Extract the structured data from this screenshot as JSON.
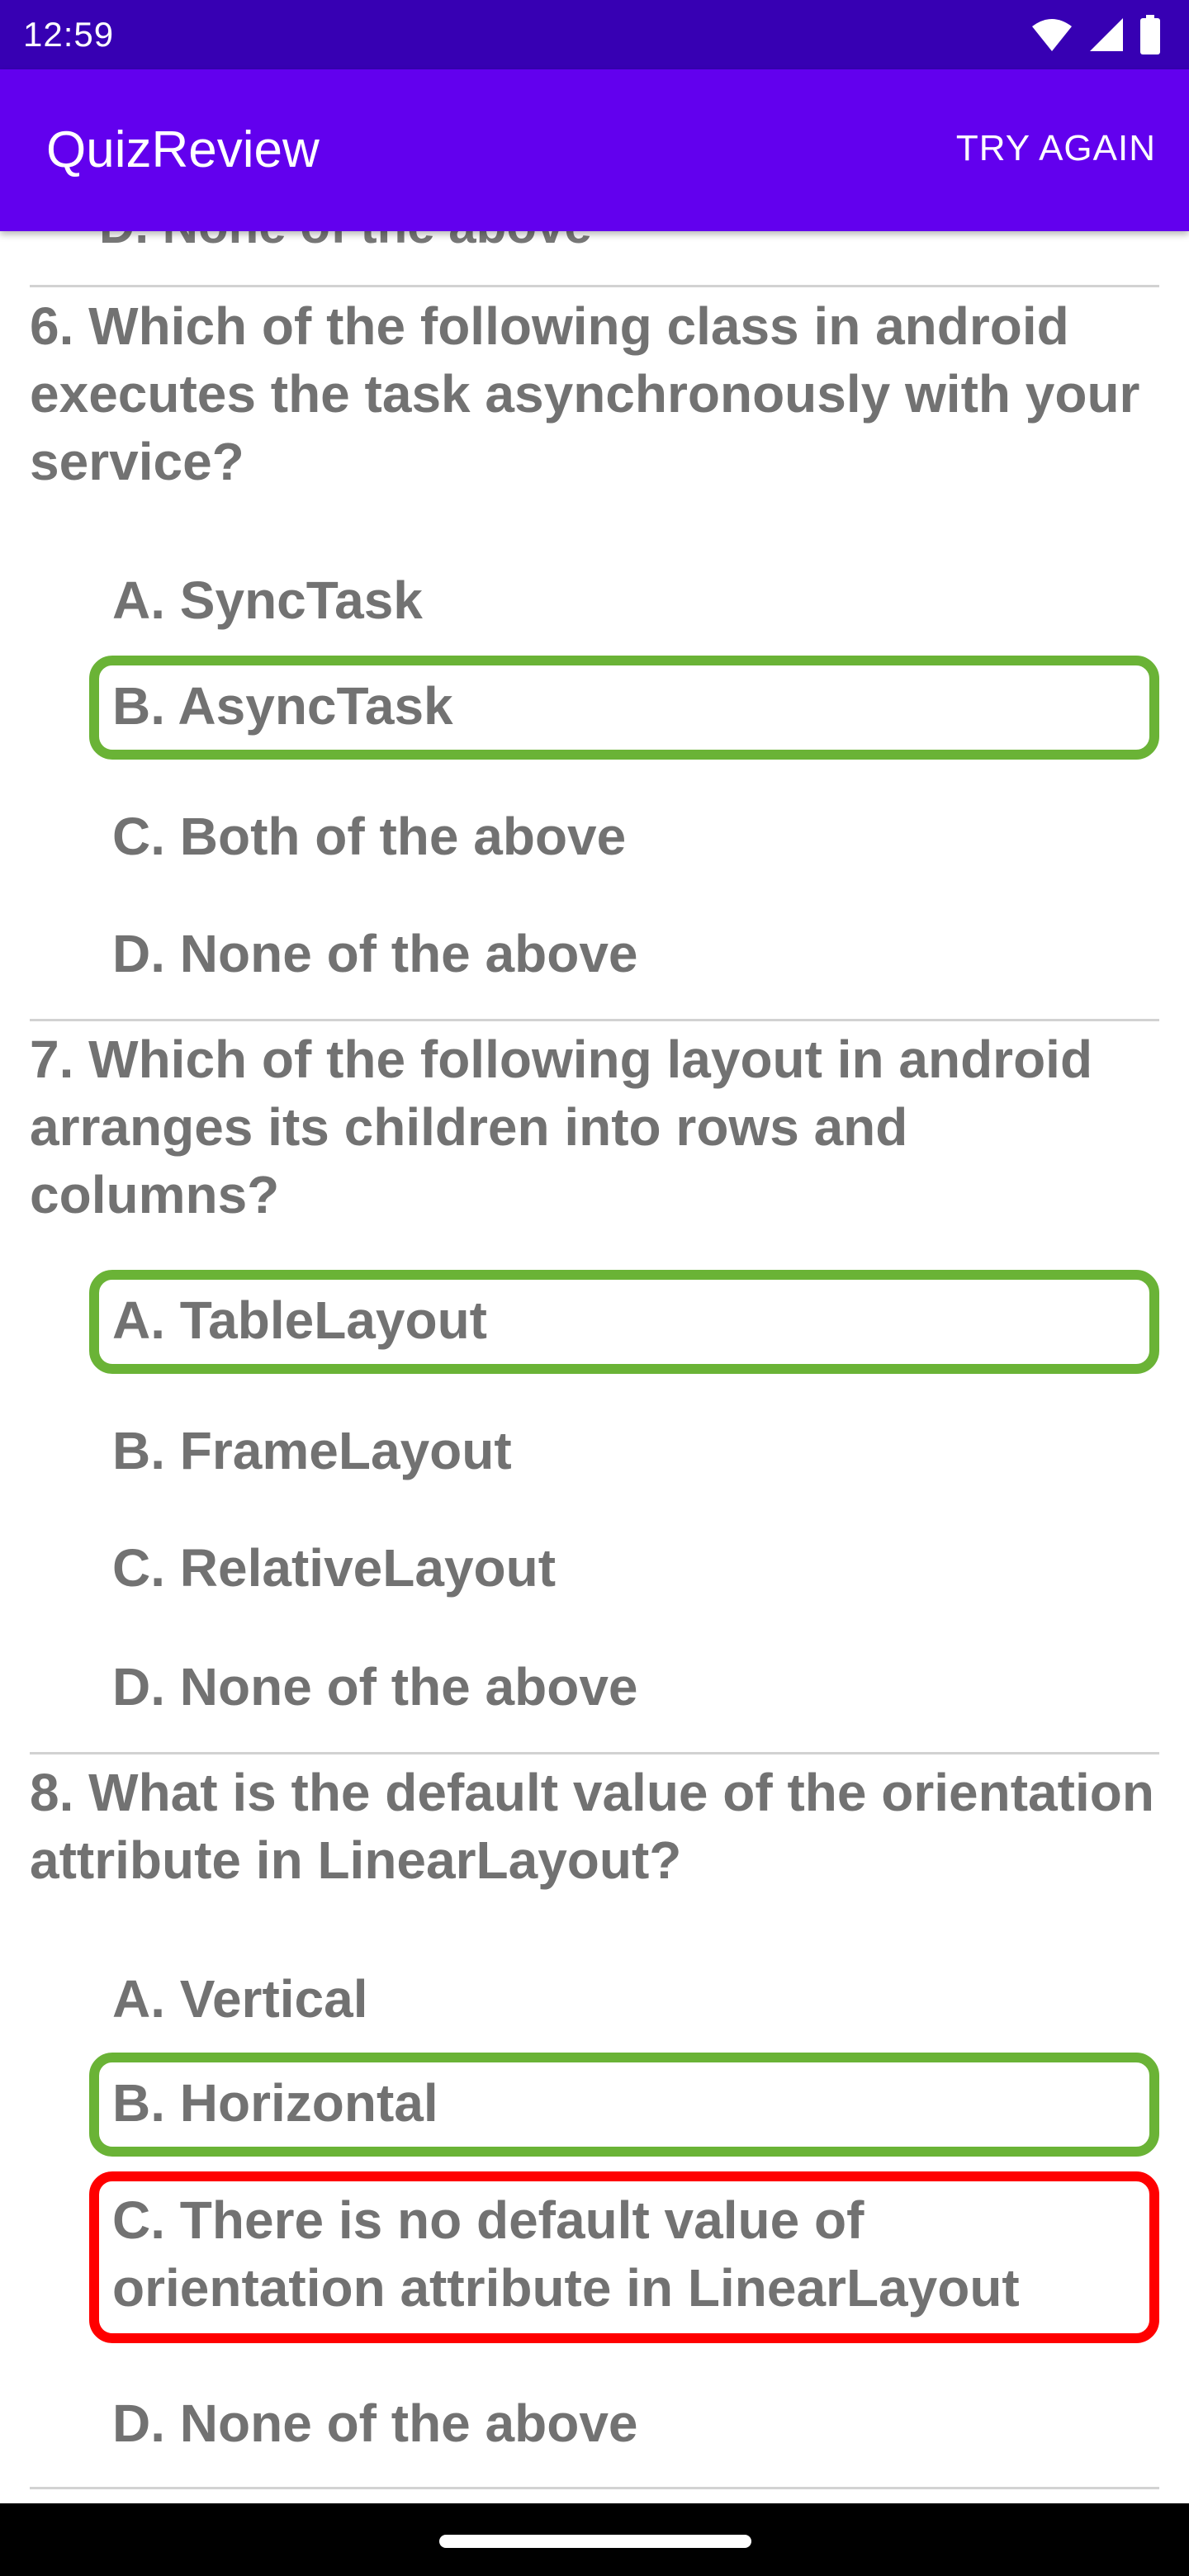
{
  "status_bar": {
    "time": "12:59",
    "icons": [
      "wifi-icon",
      "signal-icon",
      "battery-icon"
    ]
  },
  "app_bar": {
    "title": "QuizReview",
    "action": "TRY AGAIN",
    "color": "#6200ee",
    "status_color": "#3700b3"
  },
  "colors": {
    "correct_border": "#6ab336",
    "wrong_border": "#ff0000",
    "text": "#727272"
  },
  "questions": [
    {
      "question": "6. Which of the following class in android executes the task asynchronously with your service?",
      "options": [
        {
          "label": "A. SyncTask",
          "state": "none"
        },
        {
          "label": "B. AsyncTask",
          "state": "correct"
        },
        {
          "label": "C. Both of the above",
          "state": "none"
        },
        {
          "label": "D. None of the above",
          "state": "none"
        }
      ]
    },
    {
      "question": "7. Which of the following layout in android arranges its children into rows and columns?",
      "options": [
        {
          "label": "A. TableLayout",
          "state": "correct"
        },
        {
          "label": "B. FrameLayout",
          "state": "none"
        },
        {
          "label": "C. RelativeLayout",
          "state": "none"
        },
        {
          "label": "D. None of the above",
          "state": "none"
        }
      ]
    },
    {
      "question": "8. What is the default value of the orientation attribute in LinearLayout?",
      "options": [
        {
          "label": "A. Vertical",
          "state": "none"
        },
        {
          "label": "B. Horizontal",
          "state": "correct"
        },
        {
          "label": "C. There is no default value of orientation attribute in LinearLayout",
          "state": "wrong"
        },
        {
          "label": "D. None of the above",
          "state": "none"
        }
      ]
    }
  ]
}
